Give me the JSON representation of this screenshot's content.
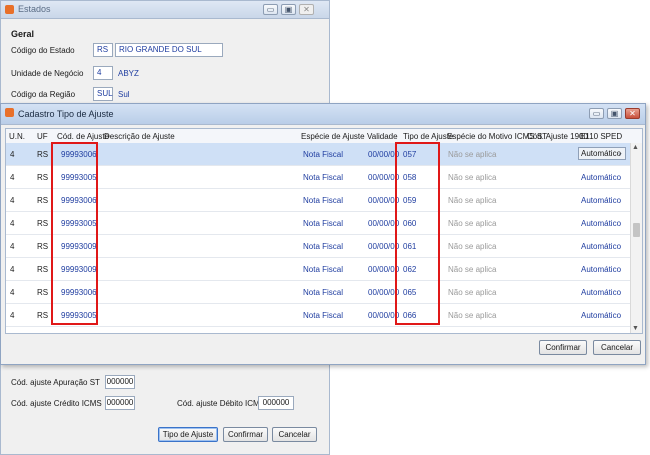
{
  "back_window": {
    "title": "Estados",
    "section": "Geral",
    "fields": [
      {
        "label": "Código do Estado",
        "code": "RS",
        "value": "RIO GRANDE DO SUL"
      },
      {
        "label": "Unidade de Negócio",
        "code": "4",
        "value": "ABYZ"
      },
      {
        "label": "Código da Região",
        "code": "SUL",
        "value": "Sul"
      }
    ],
    "lower_fields": {
      "apuracao_st": {
        "label": "Cód. ajuste Apuração ST",
        "value": "000000"
      },
      "credito_icms": {
        "label": "Cód. ajuste Crédito ICMS",
        "value": "000000"
      },
      "debito_icms": {
        "label": "Cód. ajuste Débito ICMS",
        "value": "000000"
      }
    },
    "buttons": {
      "tipo": "Tipo de Ajuste",
      "confirmar": "Confirmar",
      "cancelar": "Cancelar"
    }
  },
  "modal": {
    "title": "Cadastro Tipo de Ajuste",
    "columns": [
      "U.N.",
      "UF",
      "Cód. de Ajuste",
      "Descrição de Ajuste",
      "Espécie de Ajuste",
      "Validade",
      "Tipo de Ajuste",
      "Espécie do Motivo ICMS ST",
      "Cód. Ajuste 1900",
      "E110 SPED"
    ],
    "rows": [
      {
        "un": "4",
        "uf": "RS",
        "cod": "99993006",
        "desc": "",
        "especie": "Nota Fiscal",
        "validade": "00/00/00",
        "tipo": "057",
        "motivo": "Não se aplica",
        "e110": "Automático"
      },
      {
        "un": "4",
        "uf": "RS",
        "cod": "99993005",
        "desc": "",
        "especie": "Nota Fiscal",
        "validade": "00/00/00",
        "tipo": "058",
        "motivo": "Não se aplica",
        "e110": "Automático"
      },
      {
        "un": "4",
        "uf": "RS",
        "cod": "99993006",
        "desc": "",
        "especie": "Nota Fiscal",
        "validade": "00/00/00",
        "tipo": "059",
        "motivo": "Não se aplica",
        "e110": "Automático"
      },
      {
        "un": "4",
        "uf": "RS",
        "cod": "99993005",
        "desc": "",
        "especie": "Nota Fiscal",
        "validade": "00/00/00",
        "tipo": "060",
        "motivo": "Não se aplica",
        "e110": "Automático"
      },
      {
        "un": "4",
        "uf": "RS",
        "cod": "99993009",
        "desc": "",
        "especie": "Nota Fiscal",
        "validade": "00/00/00",
        "tipo": "061",
        "motivo": "Não se aplica",
        "e110": "Automático"
      },
      {
        "un": "4",
        "uf": "RS",
        "cod": "99993009",
        "desc": "",
        "especie": "Nota Fiscal",
        "validade": "00/00/00",
        "tipo": "062",
        "motivo": "Não se aplica",
        "e110": "Automático"
      },
      {
        "un": "4",
        "uf": "RS",
        "cod": "99993006",
        "desc": "",
        "especie": "Nota Fiscal",
        "validade": "00/00/00",
        "tipo": "065",
        "motivo": "Não se aplica",
        "e110": "Automático"
      },
      {
        "un": "4",
        "uf": "RS",
        "cod": "99993005",
        "desc": "",
        "especie": "Nota Fiscal",
        "validade": "00/00/00",
        "tipo": "066",
        "motivo": "Não se aplica",
        "e110": "Automático"
      }
    ],
    "buttons": {
      "confirmar": "Confirmar",
      "cancelar": "Cancelar"
    }
  },
  "colors": {
    "highlight": "#e01818",
    "selected_row": "#cfe0f6",
    "value_text": "#1f3da0"
  }
}
